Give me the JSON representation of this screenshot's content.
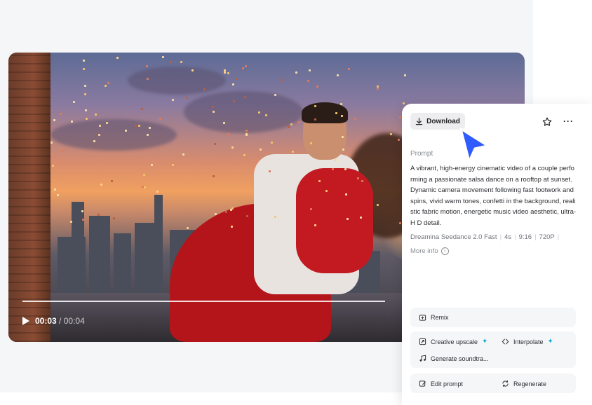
{
  "video": {
    "time_current": "00:03",
    "time_separator": "/",
    "time_total": "00:04",
    "progress": 0.75
  },
  "panel": {
    "download_label": "Download",
    "prompt_label": "Prompt",
    "prompt_text": "A vibrant, high-energy cinematic video of a couple performing a passionate salsa dance on a rooftop at sunset. Dynamic camera movement following fast footwork and spins, vivid warm tones, confetti in the background, realistic fabric motion, energetic music video aesthetic, ultra-H D detail.",
    "meta": {
      "model": "Dreamina Seedance 2.0 Fast",
      "duration": "4s",
      "ratio": "9:16",
      "resolution": "720P"
    },
    "more_info_label": "More info",
    "remix_label": "Remix",
    "tools": {
      "creative_upscale": "Creative upscale",
      "interpolate": "Interpolate",
      "generate_soundtrack": "Generate soundtra...",
      "edit_prompt": "Edit prompt",
      "regenerate": "Regenerate"
    }
  },
  "colors": {
    "accent_blue": "#2f5bff",
    "sparkle": "#19a7d6",
    "dress_red": "#b4151b"
  },
  "icons": [
    "play-icon",
    "download-icon",
    "star-icon",
    "more-icon",
    "cursor-icon",
    "info-icon",
    "remix-icon",
    "upscale-icon",
    "interpolate-icon",
    "music-icon",
    "edit-icon",
    "regenerate-icon",
    "sparkle-icon"
  ]
}
